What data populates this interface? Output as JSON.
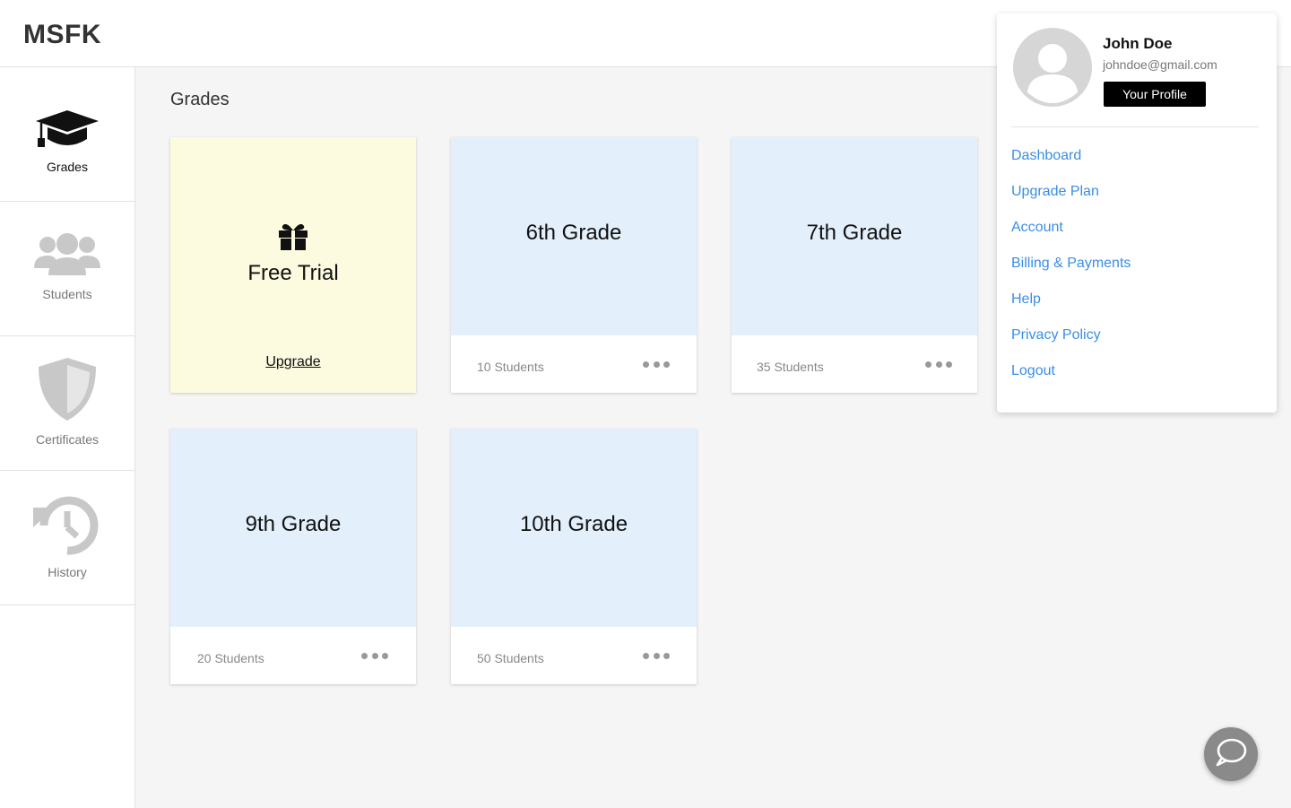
{
  "app": {
    "logo": "MSFK"
  },
  "sidebar": {
    "items": [
      {
        "label": "Grades",
        "icon": "graduation-cap-icon",
        "active": true
      },
      {
        "label": "Students",
        "icon": "users-icon",
        "active": false
      },
      {
        "label": "Certificates",
        "icon": "shield-icon",
        "active": false
      },
      {
        "label": "History",
        "icon": "history-icon",
        "active": false
      }
    ]
  },
  "main": {
    "title": "Grades",
    "trial": {
      "title": "Free Trial",
      "upgrade_label": "Upgrade",
      "icon": "gift-icon"
    },
    "grades": [
      {
        "name": "6th Grade",
        "students": "10 Students"
      },
      {
        "name": "7th Grade",
        "students": "35 Students"
      },
      {
        "name": "9th Grade",
        "students": "20 Students"
      },
      {
        "name": "10th Grade",
        "students": "50 Students"
      }
    ]
  },
  "profile_menu": {
    "name": "John Doe",
    "email": "johndoe@gmail.com",
    "profile_button": "Your Profile",
    "links": [
      "Dashboard",
      "Upgrade Plan",
      "Account",
      "Billing & Payments",
      "Help",
      "Privacy Policy",
      "Logout"
    ]
  },
  "colors": {
    "accent": "#3a8ee6",
    "card_blue": "#e3f0fc",
    "card_yellow": "#fcfbdf",
    "chat_button": "#8a8a8a"
  }
}
